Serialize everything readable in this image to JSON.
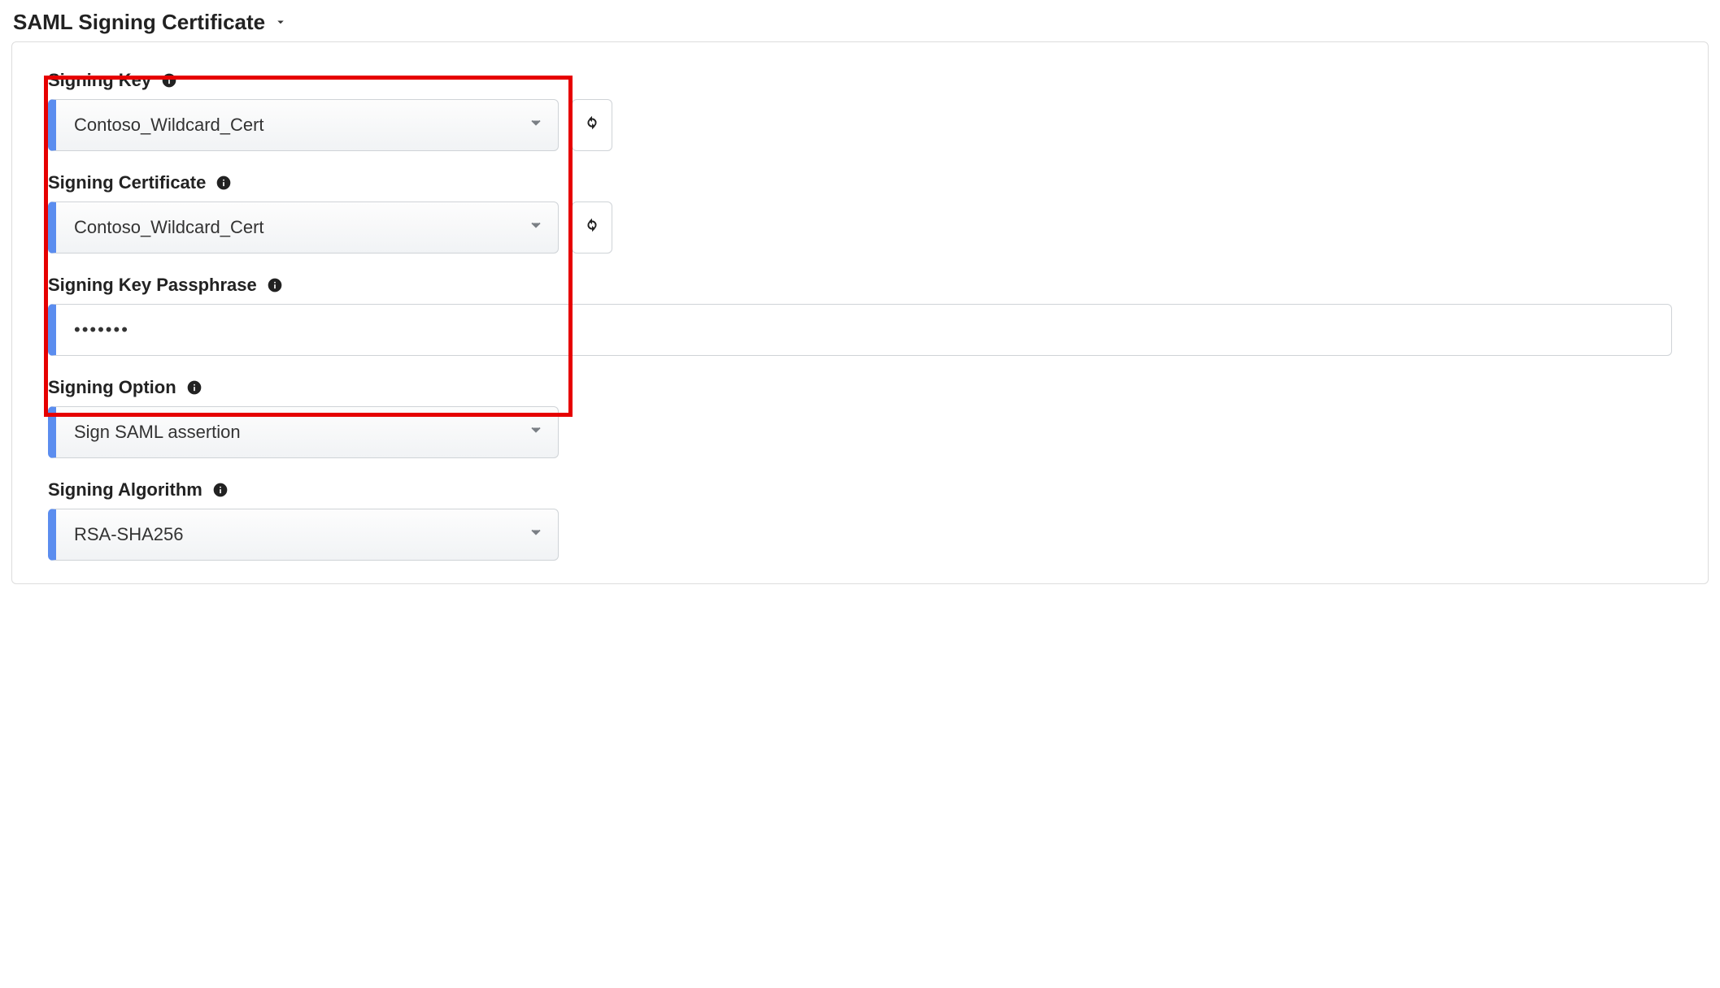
{
  "section": {
    "title": "SAML Signing Certificate"
  },
  "fields": {
    "signing_key": {
      "label": "Signing Key",
      "value": "Contoso_Wildcard_Cert"
    },
    "signing_certificate": {
      "label": "Signing Certificate",
      "value": "Contoso_Wildcard_Cert"
    },
    "passphrase": {
      "label": "Signing Key Passphrase",
      "value": "•••••••"
    },
    "signing_option": {
      "label": "Signing Option",
      "value": "Sign SAML assertion"
    },
    "signing_algorithm": {
      "label": "Signing Algorithm",
      "value": "RSA-SHA256"
    }
  }
}
